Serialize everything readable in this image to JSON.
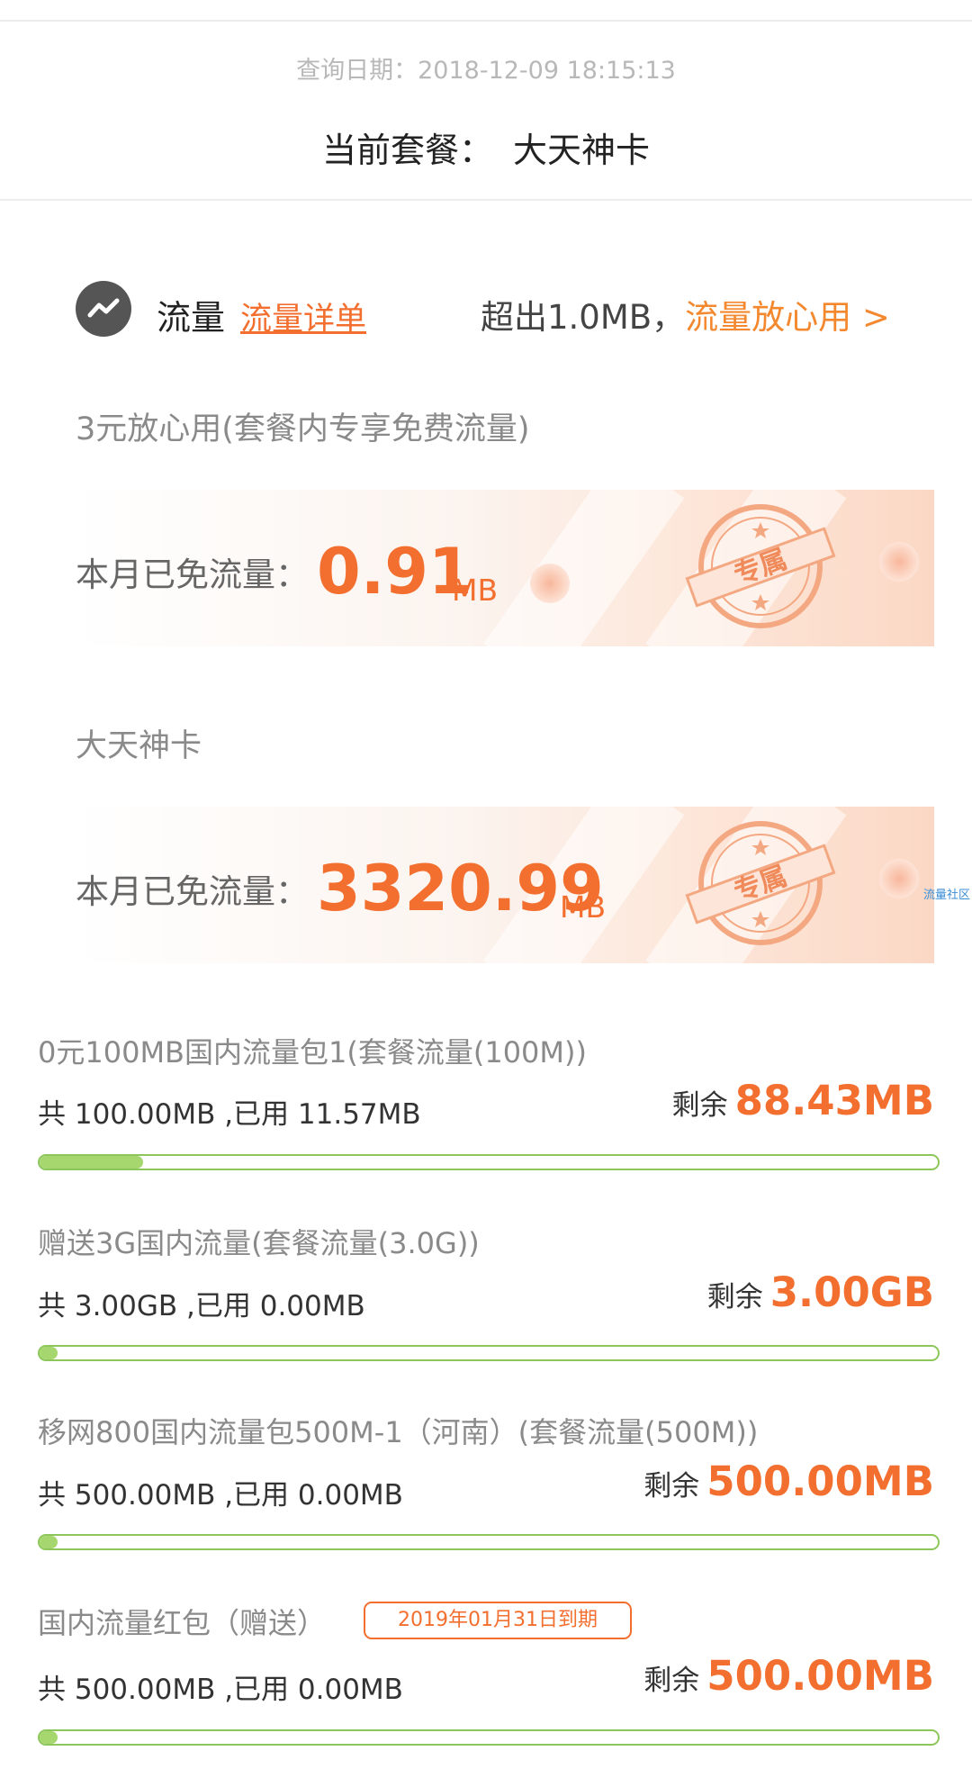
{
  "header": {
    "query_date": "查询日期：2018-12-09 18:15:13",
    "plan_label": "当前套餐：",
    "plan_name": "大天神卡"
  },
  "flow": {
    "icon": "trend-chart-icon",
    "title": "流量",
    "detail_link": "流量详单",
    "exceed_text": "超出1.0MB，",
    "worry_free_link": "流量放心用 >"
  },
  "free_sections": [
    {
      "title": "3元放心用(套餐内专享免费流量)",
      "label": "本月已免流量：",
      "value": "0.91",
      "unit": "MB",
      "stamp_text": "专属"
    },
    {
      "title": "大天神卡",
      "label": "本月已免流量：",
      "value": "3320.99",
      "unit": "MB",
      "stamp_text": "专属"
    }
  ],
  "side_tag": "流量社区",
  "packages": [
    {
      "name": "0元100MB国内流量包1(套餐流量(100M))",
      "usage": "共 100.00MB ,已用 11.57MB",
      "remain_label": "剩余",
      "remain_value": "88.43MB",
      "used_fraction": 0.1157
    },
    {
      "name": "赠送3G国内流量(套餐流量(3.0G))",
      "usage": "共 3.00GB ,已用 0.00MB",
      "remain_label": "剩余",
      "remain_value": "3.00GB",
      "used_fraction": 0.0
    },
    {
      "name": "移网800国内流量包500M-1（河南）(套餐流量(500M))",
      "usage": "共 500.00MB ,已用 0.00MB",
      "remain_label": "剩余",
      "remain_value": "500.00MB",
      "used_fraction": 0.0
    },
    {
      "name": "国内流量红包（赠送）",
      "expire_badge": "2019年01月31日到期",
      "usage": "共 500.00MB ,已用 0.00MB",
      "remain_label": "剩余",
      "remain_value": "500.00MB",
      "used_fraction": 0.0
    }
  ],
  "colors": {
    "accent": "#f36f2f",
    "bar_border": "#8dc75b",
    "bar_fill": "#a6d76e"
  }
}
